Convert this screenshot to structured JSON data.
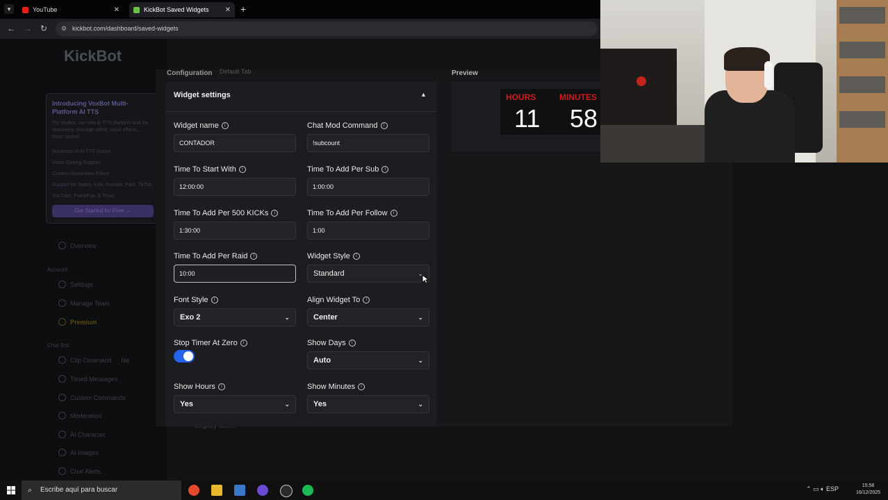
{
  "browser": {
    "tabs": [
      {
        "label": "YouTube"
      },
      {
        "label": "KickBot Saved Widgets"
      }
    ],
    "new_tab": "+",
    "url": "kickbot.com/dashboard/saved-widgets"
  },
  "sidebar": {
    "logo": "KickBot",
    "promo": {
      "title": "Introducing VoxBot Multi-Platform AI TTS",
      "text": "Try VoxBot, our new AI TTS platform built for streamers. Manage alerts, voice effects, more control.",
      "features": [
        "Hundreds of AI TTS Voices",
        "Voice Cloning Support",
        "Custom Moderation Filters",
        "Support for Twitch, Kick, Rumble, Parti, TikTok, YouTube, PumpFun, & Trovo"
      ],
      "cta": "Get Started for Free →"
    },
    "items_top": [
      "Overview"
    ],
    "account_header": "Account",
    "account_items": [
      "Settings",
      "Manage Team",
      "Premium"
    ],
    "chatbot_header": "Chat Bot",
    "chatbot_items": [
      "Clip Command",
      "Timed Messages",
      "Custom Commands",
      "Moderation",
      "AI Character",
      "AI Images",
      "Chat Alerts"
    ],
    "new_badge": "Ne"
  },
  "tabs": {
    "configuration": "Configuration",
    "second": "Default Tab"
  },
  "card": {
    "title": "Widget settings",
    "fields": {
      "widget_name": {
        "label": "Widget name",
        "value": "CONTADOR"
      },
      "chat_mod_command": {
        "label": "Chat Mod Command",
        "value": "!subcount"
      },
      "time_to_start": {
        "label": "Time To Start With",
        "value": "12:00:00"
      },
      "time_per_sub": {
        "label": "Time To Add Per Sub",
        "value": "1:00:00"
      },
      "time_per_500_kicks": {
        "label": "Time To Add Per 500 KICKs",
        "value": "1:30:00"
      },
      "time_per_follow": {
        "label": "Time To Add Per Follow",
        "value": "1:00"
      },
      "time_per_raid": {
        "label": "Time To Add Per Raid",
        "value": "10:00"
      },
      "widget_style": {
        "label": "Widget Style",
        "value": "Standard"
      },
      "font_style": {
        "label": "Font Style",
        "value": "Exo 2"
      },
      "align_widget": {
        "label": "Align Widget To",
        "value": "Center"
      },
      "stop_timer": {
        "label": "Stop Timer At Zero",
        "value": true
      },
      "show_days": {
        "label": "Show Days",
        "value": "Auto"
      },
      "show_hours": {
        "label": "Show Hours",
        "value": "Yes"
      },
      "show_minutes": {
        "label": "Show Minutes",
        "value": "Yes"
      }
    }
  },
  "legacy": "Legacy alerts",
  "preview": {
    "label": "Preview",
    "hours_label": "HOURS",
    "hours_value": "11",
    "minutes_label": "MINUTES",
    "minutes_value": "58"
  },
  "taskbar": {
    "search_placeholder": "Escribe aquí para buscar",
    "lang": "ESP",
    "time": "15:58",
    "date": "16/12/2025"
  },
  "colors": {
    "accent": "#2563eb",
    "timer_label": "#d11a1a"
  }
}
